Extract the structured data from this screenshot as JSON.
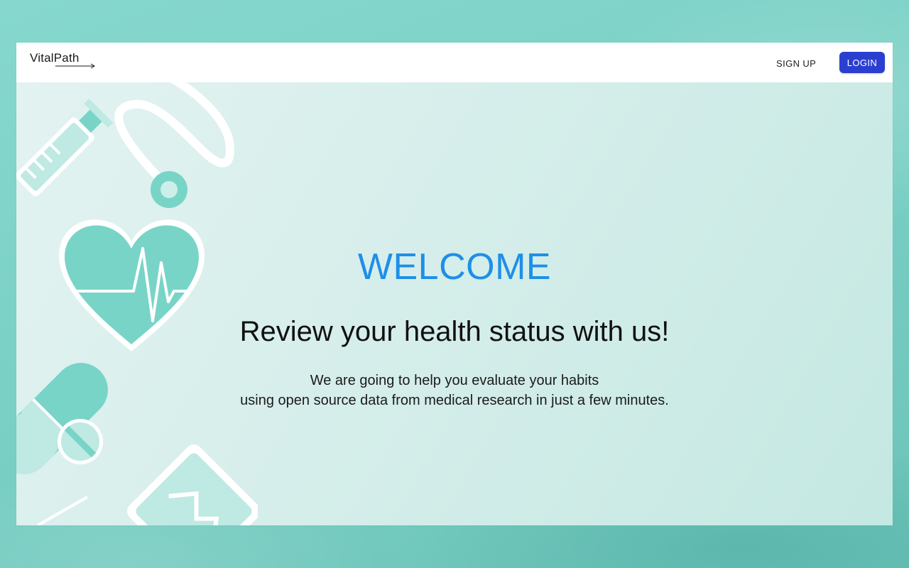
{
  "brand": {
    "name": "VitalPath"
  },
  "nav": {
    "signup_label": "SIGN UP",
    "login_label": "LOGIN"
  },
  "hero": {
    "title": "WELCOME",
    "subtitle": "Review your health status with us!",
    "description_lines": [
      "We are going to help you evaluate your habits",
      "using open source data from medical research in just a few minutes."
    ]
  },
  "colors": {
    "accent_blue": "#1e8fe8",
    "button_blue": "#2a3fd0",
    "teal": "#79d4c8",
    "page_background": "#7fd3c9"
  },
  "illustration_icons": [
    "syringe-icon",
    "stethoscope-icon",
    "heart-pulse-icon",
    "capsule-icon",
    "pill-icon",
    "clipboard-icon"
  ]
}
